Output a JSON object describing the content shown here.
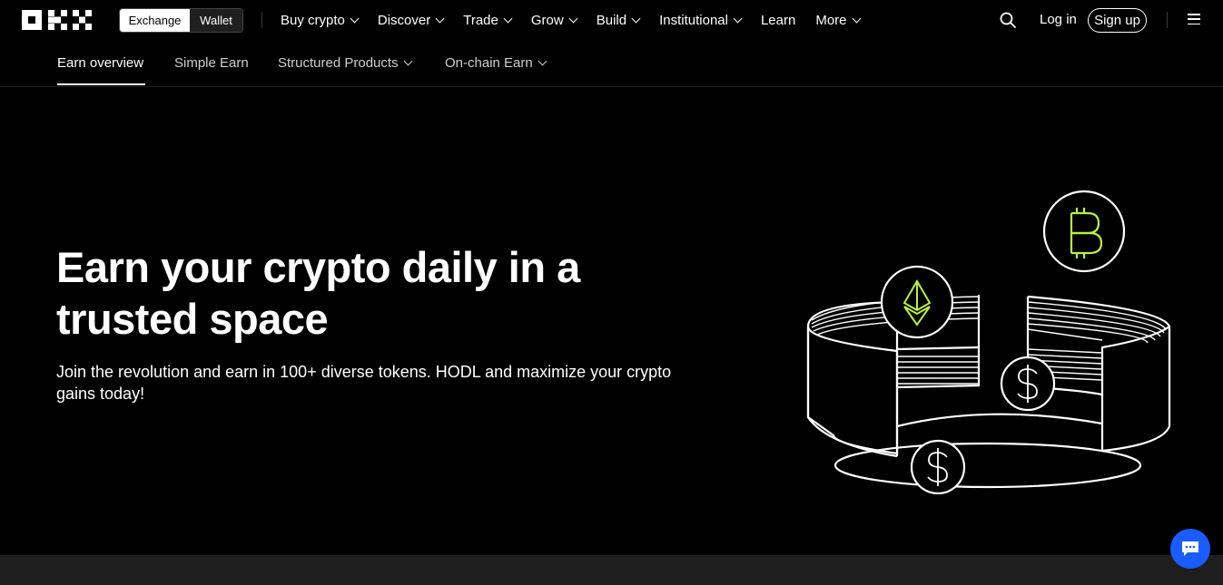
{
  "brand": {
    "logo_icon": "okx-logo"
  },
  "platform_toggle": {
    "active": "Exchange",
    "inactive": "Wallet"
  },
  "menu": [
    {
      "label": "Buy crypto",
      "dropdown": true
    },
    {
      "label": "Discover",
      "dropdown": true
    },
    {
      "label": "Trade",
      "dropdown": true
    },
    {
      "label": "Grow",
      "dropdown": true
    },
    {
      "label": "Build",
      "dropdown": true
    },
    {
      "label": "Institutional",
      "dropdown": true
    },
    {
      "label": "Learn",
      "dropdown": false
    },
    {
      "label": "More",
      "dropdown": true
    }
  ],
  "auth": {
    "login": "Log in",
    "signup": "Sign up"
  },
  "subnav": [
    {
      "label": "Earn overview",
      "active": true
    },
    {
      "label": "Simple Earn",
      "active": false
    },
    {
      "label": "Structured Products",
      "active": false
    },
    {
      "label": "On-chain Earn",
      "active": false
    }
  ],
  "hero": {
    "title": "Earn your crypto daily in a trusted space",
    "subtitle": "Join the revolution and earn in 100+ diverse tokens. HODL and maximize your crypto gains today!"
  },
  "colors": {
    "accent_green": "#b8f23c",
    "chat_blue": "#1a5cff",
    "background": "#000000"
  }
}
